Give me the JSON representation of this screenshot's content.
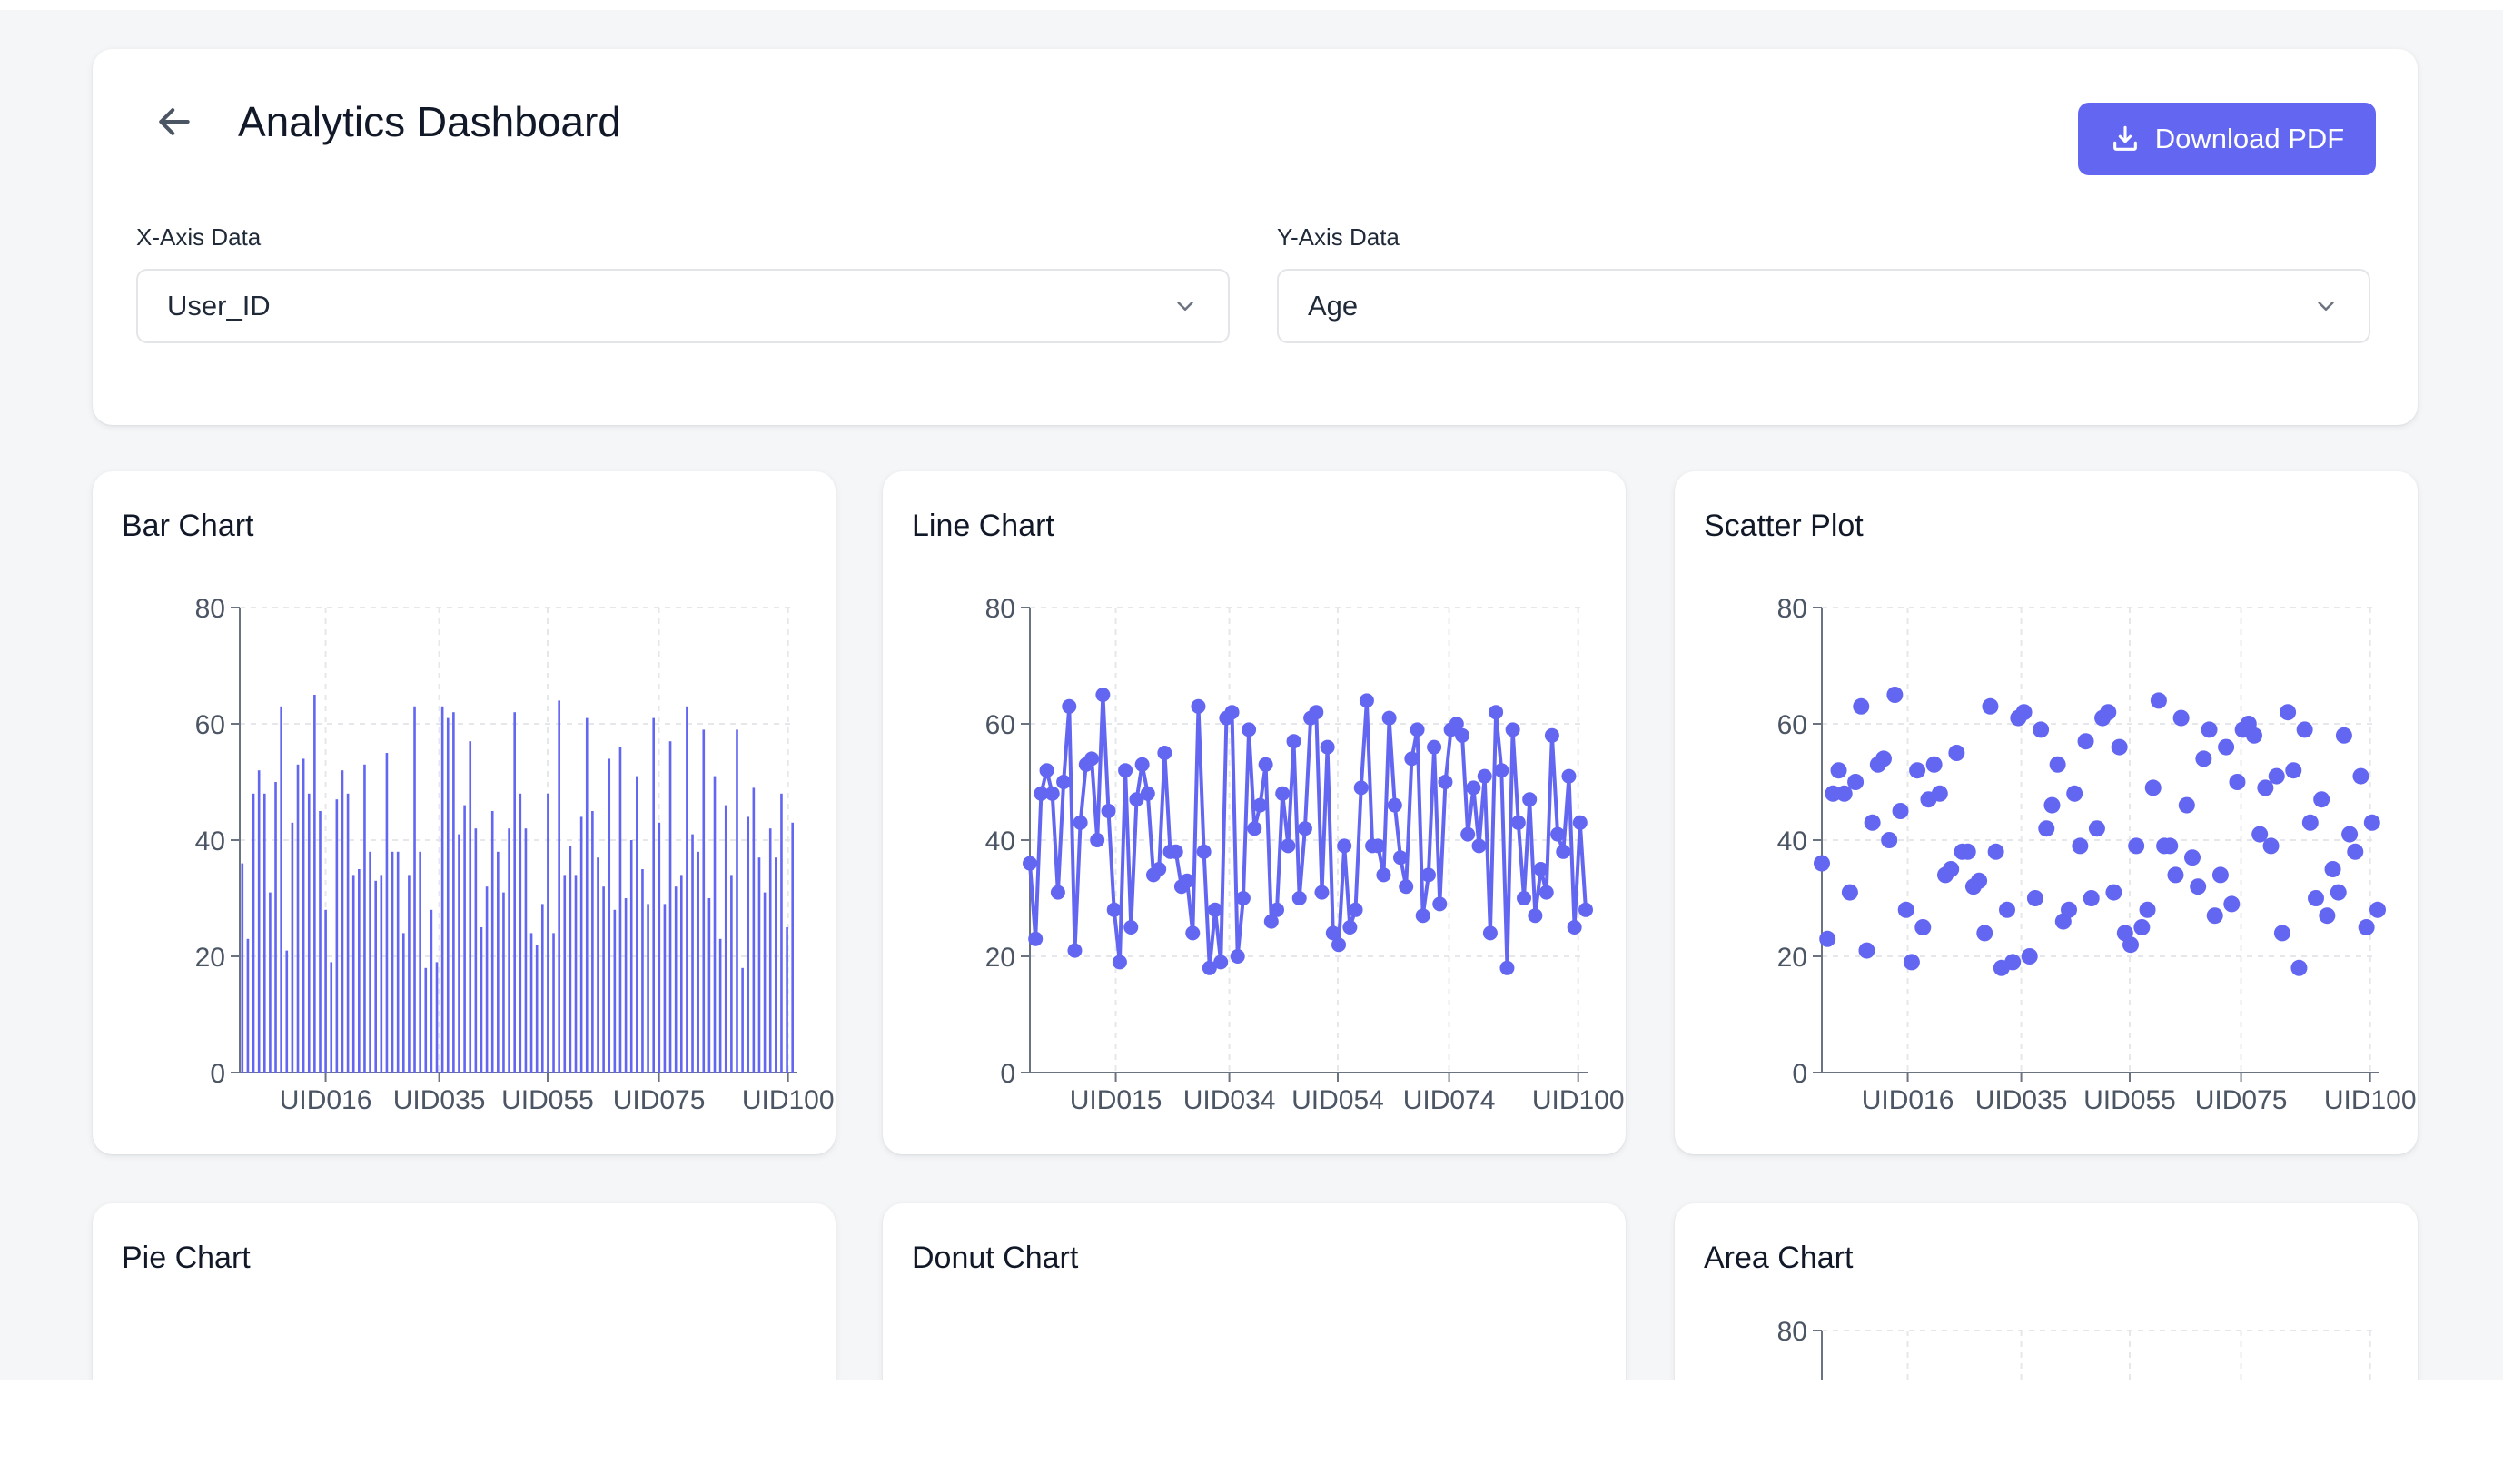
{
  "header": {
    "title": "Analytics Dashboard",
    "back_icon": "arrow-left-icon",
    "download_label": "Download PDF",
    "download_icon": "download-icon",
    "accent_color": "#6366f1"
  },
  "filters": {
    "x_axis": {
      "label": "X-Axis Data",
      "value": "User_ID",
      "icon": "chevron-down-icon"
    },
    "y_axis": {
      "label": "Y-Axis Data",
      "value": "Age",
      "icon": "chevron-down-icon"
    }
  },
  "charts": {
    "bar": {
      "title": "Bar Chart"
    },
    "line": {
      "title": "Line Chart"
    },
    "scatter": {
      "title": "Scatter Plot"
    },
    "pie": {
      "title": "Pie Chart"
    },
    "donut": {
      "title": "Donut Chart"
    },
    "area": {
      "title": "Area Chart"
    }
  },
  "chart_data": [
    {
      "type": "bar",
      "title": "Bar Chart",
      "x_tick_labels": [
        "UID016",
        "UID035",
        "UID055",
        "UID075",
        "UID100"
      ],
      "y_ticks": [
        0,
        20,
        40,
        60,
        80
      ],
      "ylim": [
        0,
        80
      ],
      "grid": true,
      "color": "#6366f1",
      "values": [
        36,
        23,
        48,
        52,
        48,
        31,
        50,
        63,
        21,
        43,
        53,
        54,
        48,
        65,
        45,
        28,
        19,
        47,
        52,
        48,
        34,
        35,
        53,
        38,
        33,
        34,
        55,
        38,
        38,
        24,
        34,
        63,
        38,
        18,
        28,
        19,
        63,
        61,
        62,
        41,
        46,
        57,
        42,
        25,
        32,
        45,
        38,
        31,
        42,
        62,
        48,
        42,
        24,
        22,
        29,
        48,
        24,
        64,
        34,
        39,
        34,
        44,
        61,
        45,
        37,
        32,
        54,
        28,
        56,
        30,
        40,
        51,
        35,
        29,
        61,
        43,
        29,
        57,
        32,
        34,
        63,
        41,
        38,
        59,
        30,
        51,
        23,
        46,
        34,
        59,
        18,
        44,
        49,
        37,
        31,
        42,
        37,
        48,
        25,
        43
      ]
    },
    {
      "type": "line",
      "title": "Line Chart",
      "x_tick_labels": [
        "UID015",
        "UID034",
        "UID054",
        "UID074",
        "UID100"
      ],
      "y_ticks": [
        0,
        20,
        40,
        60,
        80
      ],
      "ylim": [
        0,
        80
      ],
      "grid": true,
      "color": "#6366f1",
      "values": [
        36,
        23,
        48,
        52,
        48,
        31,
        50,
        63,
        21,
        43,
        53,
        54,
        40,
        65,
        45,
        28,
        19,
        52,
        25,
        47,
        53,
        48,
        34,
        35,
        55,
        38,
        38,
        32,
        33,
        24,
        63,
        38,
        18,
        28,
        19,
        61,
        62,
        20,
        30,
        59,
        42,
        46,
        53,
        26,
        28,
        48,
        39,
        57,
        30,
        42,
        61,
        62,
        31,
        56,
        24,
        22,
        39,
        25,
        28,
        49,
        64,
        39,
        39,
        34,
        61,
        46,
        37,
        32,
        54,
        59,
        27,
        34,
        56,
        29,
        50,
        59,
        60,
        58,
        41,
        49,
        39,
        51,
        24,
        62,
        52,
        18,
        59,
        43,
        30,
        47,
        27,
        35,
        31,
        58,
        41,
        38,
        51,
        25,
        43,
        28
      ]
    },
    {
      "type": "scatter",
      "title": "Scatter Plot",
      "x_tick_labels": [
        "UID016",
        "UID035",
        "UID055",
        "UID075",
        "UID100"
      ],
      "y_ticks": [
        0,
        20,
        40,
        60,
        80
      ],
      "ylim": [
        0,
        80
      ],
      "grid": true,
      "color": "#6366f1",
      "values": [
        36,
        23,
        48,
        52,
        48,
        31,
        50,
        63,
        21,
        43,
        53,
        54,
        40,
        65,
        45,
        28,
        19,
        52,
        25,
        47,
        53,
        48,
        34,
        35,
        55,
        38,
        38,
        32,
        33,
        24,
        63,
        38,
        18,
        28,
        19,
        61,
        62,
        20,
        30,
        59,
        42,
        46,
        53,
        26,
        28,
        48,
        39,
        57,
        30,
        42,
        61,
        62,
        31,
        56,
        24,
        22,
        39,
        25,
        28,
        49,
        64,
        39,
        39,
        34,
        61,
        46,
        37,
        32,
        54,
        59,
        27,
        34,
        56,
        29,
        50,
        59,
        60,
        58,
        41,
        49,
        39,
        51,
        24,
        62,
        52,
        18,
        59,
        43,
        30,
        47,
        27,
        35,
        31,
        58,
        41,
        38,
        51,
        25,
        43,
        28
      ]
    },
    {
      "type": "area",
      "title": "Area Chart",
      "y_ticks": [
        80
      ],
      "grid": true
    }
  ]
}
